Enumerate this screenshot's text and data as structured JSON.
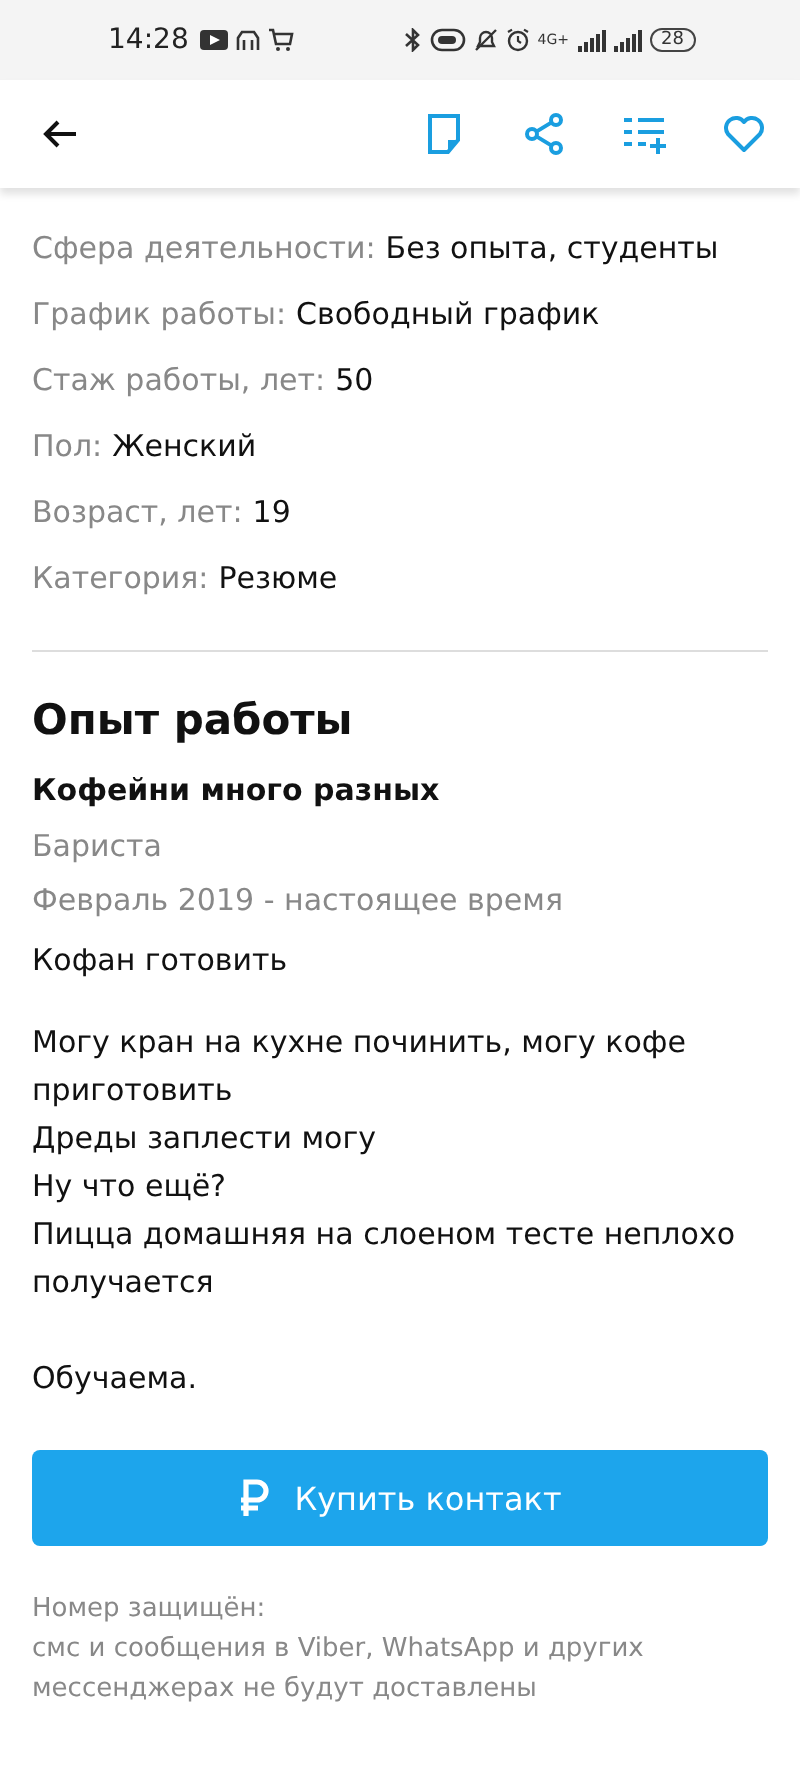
{
  "status_bar": {
    "time": "14:28",
    "network": "4G+",
    "battery": "28"
  },
  "fields": [
    {
      "label": "Сфера деятельности:",
      "value": "Без опыта, студенты"
    },
    {
      "label": "График работы:",
      "value": "Свободный график"
    },
    {
      "label": "Стаж работы, лет:",
      "value": "50"
    },
    {
      "label": "Пол:",
      "value": "Женский"
    },
    {
      "label": "Возраст, лет:",
      "value": "19"
    },
    {
      "label": "Категория:",
      "value": "Резюме"
    }
  ],
  "experience": {
    "title": "Опыт работы",
    "company": "Кофейни много разных",
    "position": "Бариста",
    "period": "Февраль 2019 - настоящее время",
    "duties": "Кофан готовить",
    "description": [
      "Могу кран на кухне починить, могу кофе приготовить",
      "Дреды заплести могу",
      "Ну что ещё?",
      "Пицца домашняя на слоеном тесте неплохо получается"
    ],
    "closing": "Обучаема."
  },
  "buy_button": {
    "label": "Купить контакт"
  },
  "notice": [
    "Номер защищён:",
    "смс и сообщения в Viber, WhatsApp и других",
    "мессенджерах не будут доставлены"
  ]
}
